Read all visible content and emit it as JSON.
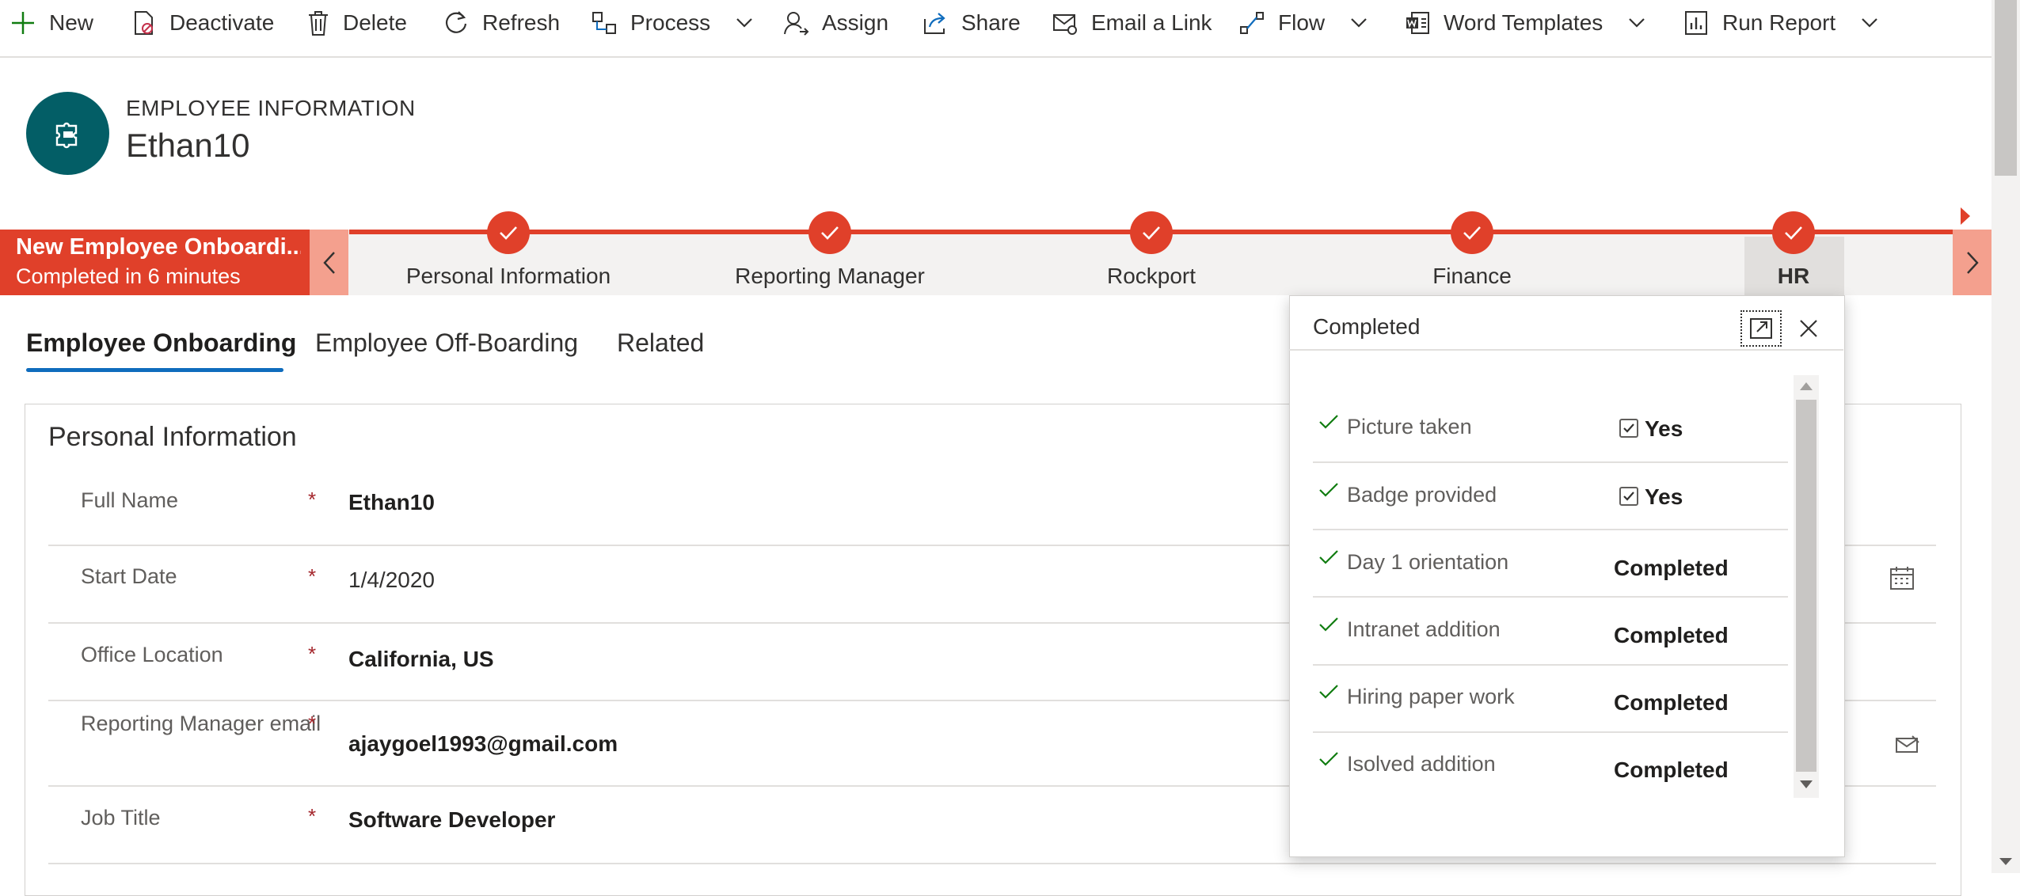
{
  "commandBar": {
    "items": [
      {
        "label": "New",
        "icon": "plus-icon"
      },
      {
        "label": "Deactivate",
        "icon": "deactivate-icon"
      },
      {
        "label": "Delete",
        "icon": "trash-icon"
      },
      {
        "label": "Refresh",
        "icon": "refresh-icon"
      },
      {
        "label": "Process",
        "icon": "process-icon",
        "hasDropdown": true
      },
      {
        "label": "Assign",
        "icon": "assign-icon"
      },
      {
        "label": "Share",
        "icon": "share-icon"
      },
      {
        "label": "Email a Link",
        "icon": "email-link-icon"
      },
      {
        "label": "Flow",
        "icon": "flow-icon",
        "hasDropdown": true
      },
      {
        "label": "Word Templates",
        "icon": "word-icon",
        "hasDropdown": true
      },
      {
        "label": "Run Report",
        "icon": "report-icon",
        "hasDropdown": true
      }
    ]
  },
  "header": {
    "entityType": "EMPLOYEE INFORMATION",
    "recordName": "Ethan10",
    "avatarIcon": "puzzle-entity-icon",
    "avatarColor": "#035e66"
  },
  "processFlow": {
    "activeProcessName": "New Employee Onboardi...",
    "activeProcessStatus": "Completed in 6 minutes",
    "accentColor": "#e0402a",
    "stages": [
      {
        "label": "Personal Information",
        "completed": true
      },
      {
        "label": "Reporting Manager",
        "completed": true
      },
      {
        "label": "Rockport",
        "completed": true
      },
      {
        "label": "Finance",
        "completed": true
      },
      {
        "label": "HR",
        "completed": true,
        "selected": true
      }
    ]
  },
  "tabs": [
    {
      "label": "Employee Onboarding",
      "active": true
    },
    {
      "label": "Employee Off-Boarding"
    },
    {
      "label": "Related"
    }
  ],
  "form": {
    "sectionTitle": "Personal Information",
    "requiredMark": "*",
    "fields": [
      {
        "label": "Full Name",
        "value": "Ethan10"
      },
      {
        "label": "Start Date",
        "value": "1/4/2020",
        "icon": "calendar-icon"
      },
      {
        "label": "Office Location",
        "value": "California, US"
      },
      {
        "label": "Reporting Manager email",
        "value": "ajaygoel1993@gmail.com",
        "icon": "email-icon"
      },
      {
        "label": "Job Title",
        "value": "Software Developer"
      }
    ]
  },
  "flyout": {
    "title": "Completed",
    "steps": [
      {
        "label": "Picture taken",
        "type": "checkbox",
        "checked": true,
        "value": "Yes"
      },
      {
        "label": "Badge provided",
        "type": "checkbox",
        "checked": true,
        "value": "Yes"
      },
      {
        "label": "Day 1 orientation",
        "type": "text",
        "value": "Completed"
      },
      {
        "label": "Intranet addition",
        "type": "text",
        "value": "Completed"
      },
      {
        "label": "Hiring paper work",
        "type": "text",
        "value": "Completed"
      },
      {
        "label": "Isolved addition",
        "type": "text",
        "value": "Completed"
      }
    ]
  }
}
